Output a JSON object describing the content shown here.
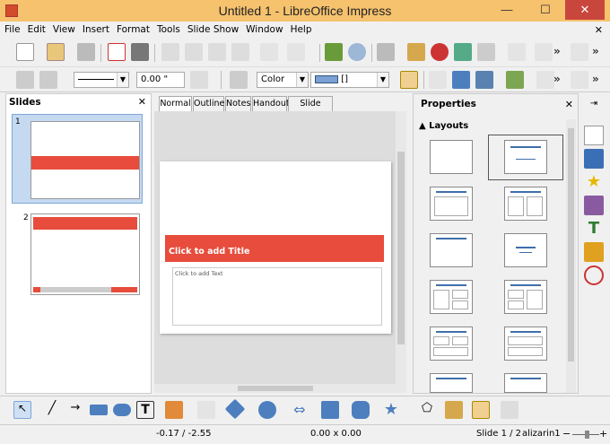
{
  "window": {
    "title": "Untitled 1 - LibreOffice Impress",
    "minimize": "—",
    "maximize": "☐",
    "close": "✕"
  },
  "menu": [
    "File",
    "Edit",
    "View",
    "Insert",
    "Format",
    "Tools",
    "Slide Show",
    "Window",
    "Help"
  ],
  "toolbar2": {
    "line_width": "0.00 \"",
    "area_style": "Color",
    "area_color": "[]"
  },
  "slides_panel": {
    "title": "Slides",
    "close": "✕",
    "slide1_num": "1",
    "slide2_num": "2"
  },
  "view_tabs": [
    "Normal",
    "Outline",
    "Notes",
    "Handout",
    "Slide Sorter"
  ],
  "slide": {
    "title_placeholder": "Click to add Title",
    "text_placeholder": "Click to add Text"
  },
  "properties": {
    "title": "Properties",
    "close": "✕",
    "section": "Layouts"
  },
  "status": {
    "position": "-0.17 / -2.55",
    "size": "0.00 x 0.00",
    "slide": "Slide 1 / 2",
    "theme": "alizarin1"
  },
  "colors": {
    "accent_red": "#e74c3c",
    "selection_blue": "#c5d9f1",
    "titlebar": "#f6c26e"
  }
}
